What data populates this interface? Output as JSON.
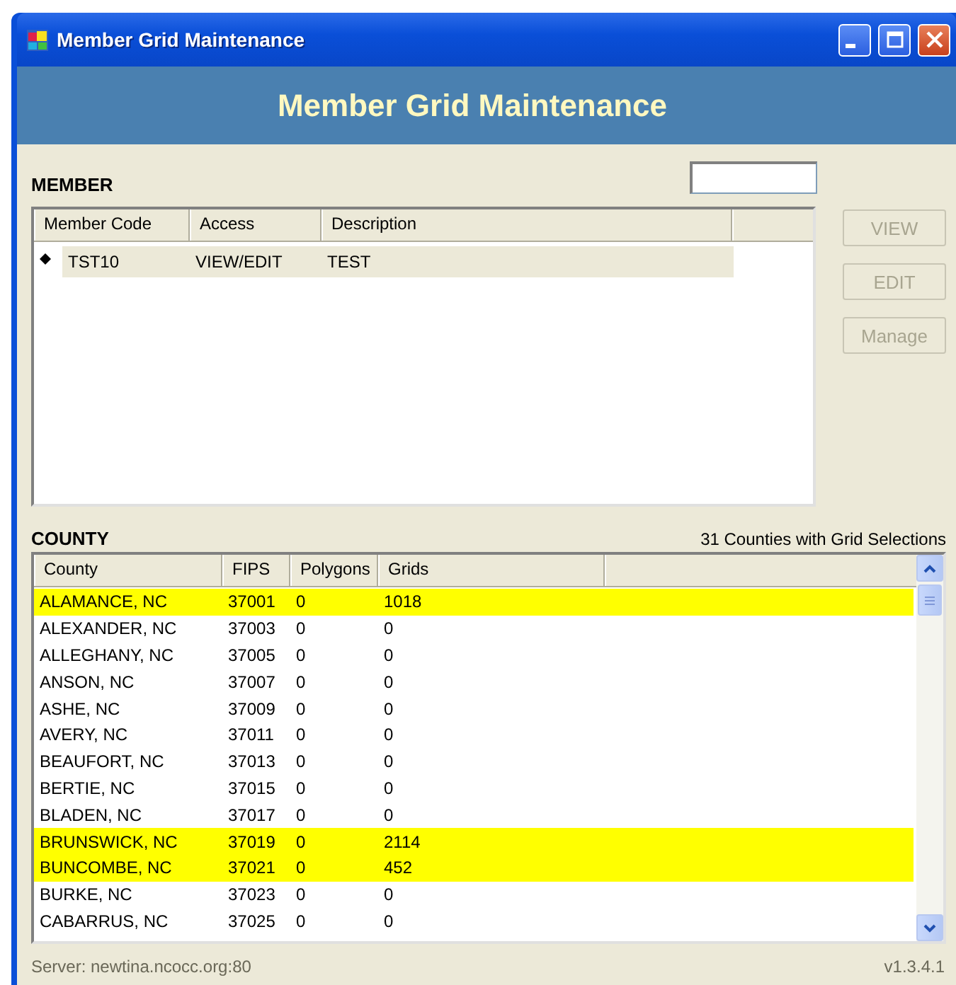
{
  "window": {
    "title": "Member Grid Maintenance"
  },
  "header": {
    "title": "Member Grid Maintenance"
  },
  "member": {
    "label": "MEMBER",
    "columns": [
      "Member Code",
      "Access",
      "Description"
    ],
    "rows": [
      {
        "cells": [
          "TST10",
          "VIEW/EDIT",
          "TEST"
        ],
        "selected": true
      }
    ],
    "buttons": [
      {
        "label": "VIEW",
        "disabled": true
      },
      {
        "label": "EDIT",
        "disabled": true
      },
      {
        "label": "Manage",
        "disabled": true
      }
    ]
  },
  "county": {
    "label": "COUNTY",
    "summary": "31 Counties with Grid Selections",
    "columns": [
      "County",
      "FIPS",
      "Polygons",
      "Grids"
    ],
    "rows": [
      {
        "cells": [
          "ALAMANCE, NC",
          "37001",
          "0",
          "1018"
        ],
        "highlighted": true
      },
      {
        "cells": [
          "ALEXANDER, NC",
          "37003",
          "0",
          "0"
        ],
        "highlighted": false
      },
      {
        "cells": [
          "ALLEGHANY, NC",
          "37005",
          "0",
          "0"
        ],
        "highlighted": false
      },
      {
        "cells": [
          "ANSON, NC",
          "37007",
          "0",
          "0"
        ],
        "highlighted": false
      },
      {
        "cells": [
          "ASHE, NC",
          "37009",
          "0",
          "0"
        ],
        "highlighted": false
      },
      {
        "cells": [
          "AVERY, NC",
          "37011",
          "0",
          "0"
        ],
        "highlighted": false
      },
      {
        "cells": [
          "BEAUFORT, NC",
          "37013",
          "0",
          "0"
        ],
        "highlighted": false
      },
      {
        "cells": [
          "BERTIE, NC",
          "37015",
          "0",
          "0"
        ],
        "highlighted": false
      },
      {
        "cells": [
          "BLADEN, NC",
          "37017",
          "0",
          "0"
        ],
        "highlighted": false
      },
      {
        "cells": [
          "BRUNSWICK, NC",
          "37019",
          "0",
          "2114"
        ],
        "highlighted": true
      },
      {
        "cells": [
          "BUNCOMBE, NC",
          "37021",
          "0",
          "452"
        ],
        "highlighted": true
      },
      {
        "cells": [
          "BURKE, NC",
          "37023",
          "0",
          "0"
        ],
        "highlighted": false
      },
      {
        "cells": [
          "CABARRUS, NC",
          "37025",
          "0",
          "0"
        ],
        "highlighted": false
      }
    ]
  },
  "status_bar": {
    "server": "Server: newtina.ncocc.org:80",
    "version": "v1.3.4.1"
  }
}
